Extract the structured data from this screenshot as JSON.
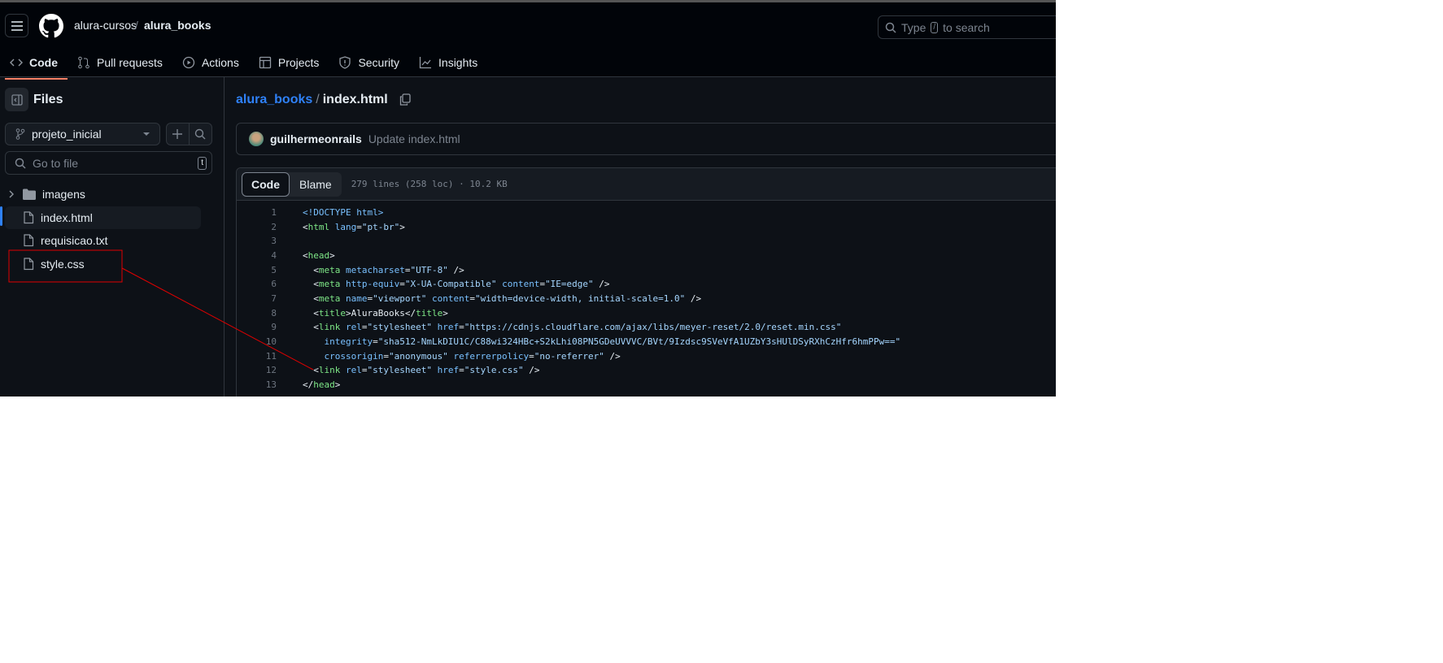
{
  "header": {
    "owner": "alura-cursos",
    "separator": "/",
    "repo": "alura_books",
    "search_placeholder": "Type",
    "search_key": "/",
    "search_suffix": "to search"
  },
  "tabs": [
    {
      "label": "Code",
      "icon": "code-icon"
    },
    {
      "label": "Pull requests",
      "icon": "pull-request-icon"
    },
    {
      "label": "Actions",
      "icon": "play-icon"
    },
    {
      "label": "Projects",
      "icon": "table-icon"
    },
    {
      "label": "Security",
      "icon": "shield-icon"
    },
    {
      "label": "Insights",
      "icon": "graph-icon"
    }
  ],
  "sidebar": {
    "title": "Files",
    "branch": "projeto_inicial",
    "goto_placeholder": "Go to file",
    "goto_key": "t",
    "items": [
      {
        "name": "imagens",
        "type": "folder"
      },
      {
        "name": "index.html",
        "type": "file",
        "selected": true
      },
      {
        "name": "requisicao.txt",
        "type": "file"
      },
      {
        "name": "style.css",
        "type": "file"
      }
    ]
  },
  "file": {
    "repo": "alura_books",
    "sep": "/",
    "name": "index.html",
    "commit_author": "guilhermeonrails",
    "commit_message": "Update index.html",
    "view_tabs": [
      "Code",
      "Blame"
    ],
    "meta": "279 lines (258 loc) · 10.2 KB"
  },
  "code_lines": [
    [
      [
        "doc",
        "<!DOCTYPE html>"
      ]
    ],
    [
      [
        "txt",
        "<"
      ],
      [
        "tag",
        "html"
      ],
      [
        "attr",
        " lang"
      ],
      [
        "txt",
        "="
      ],
      [
        "str",
        "\"pt-br\""
      ],
      [
        "txt",
        ">"
      ]
    ],
    [],
    [
      [
        "txt",
        "<"
      ],
      [
        "tag",
        "head"
      ],
      [
        "txt",
        ">"
      ]
    ],
    [
      [
        "txt",
        "  <"
      ],
      [
        "tag",
        "meta"
      ],
      [
        "attr",
        " metacharset"
      ],
      [
        "txt",
        "="
      ],
      [
        "str",
        "\"UTF-8\""
      ],
      [
        "txt",
        " />"
      ]
    ],
    [
      [
        "txt",
        "  <"
      ],
      [
        "tag",
        "meta"
      ],
      [
        "attr",
        " http-equiv"
      ],
      [
        "txt",
        "="
      ],
      [
        "str",
        "\"X-UA-Compatible\""
      ],
      [
        "attr",
        " content"
      ],
      [
        "txt",
        "="
      ],
      [
        "str",
        "\"IE=edge\""
      ],
      [
        "txt",
        " />"
      ]
    ],
    [
      [
        "txt",
        "  <"
      ],
      [
        "tag",
        "meta"
      ],
      [
        "attr",
        " name"
      ],
      [
        "txt",
        "="
      ],
      [
        "str",
        "\"viewport\""
      ],
      [
        "attr",
        " content"
      ],
      [
        "txt",
        "="
      ],
      [
        "str",
        "\"width=device-width, initial-scale=1.0\""
      ],
      [
        "txt",
        " />"
      ]
    ],
    [
      [
        "txt",
        "  <"
      ],
      [
        "tag",
        "title"
      ],
      [
        "txt",
        ">AluraBooks</"
      ],
      [
        "tag",
        "title"
      ],
      [
        "txt",
        ">"
      ]
    ],
    [
      [
        "txt",
        "  <"
      ],
      [
        "tag",
        "link"
      ],
      [
        "attr",
        " rel"
      ],
      [
        "txt",
        "="
      ],
      [
        "str",
        "\"stylesheet\""
      ],
      [
        "attr",
        " href"
      ],
      [
        "txt",
        "="
      ],
      [
        "str",
        "\"https://cdnjs.cloudflare.com/ajax/libs/meyer-reset/2.0/reset.min.css\""
      ]
    ],
    [
      [
        "attr",
        "    integrity"
      ],
      [
        "txt",
        "="
      ],
      [
        "str",
        "\"sha512-NmLkDIU1C/C88wi324HBc+S2kLhi08PN5GDeUVVVC/BVt/9Izdsc9SVeVfA1UZbY3sHUlDSyRXhCzHfr6hmPPw==\""
      ]
    ],
    [
      [
        "attr",
        "    crossorigin"
      ],
      [
        "txt",
        "="
      ],
      [
        "str",
        "\"anonymous\""
      ],
      [
        "attr",
        " referrerpolicy"
      ],
      [
        "txt",
        "="
      ],
      [
        "str",
        "\"no-referrer\""
      ],
      [
        "txt",
        " />"
      ]
    ],
    [
      [
        "txt",
        "  <"
      ],
      [
        "tag",
        "link"
      ],
      [
        "attr",
        " rel"
      ],
      [
        "txt",
        "="
      ],
      [
        "str",
        "\"stylesheet\""
      ],
      [
        "attr",
        " href"
      ],
      [
        "txt",
        "="
      ],
      [
        "str",
        "\"style.css\""
      ],
      [
        "txt",
        " />"
      ]
    ],
    [
      [
        "txt",
        "</"
      ],
      [
        "tag",
        "head"
      ],
      [
        "txt",
        ">"
      ]
    ]
  ],
  "colors": {
    "accent": "#2f81f7",
    "tab_underline": "#f78166",
    "annotation": "#e00000"
  }
}
